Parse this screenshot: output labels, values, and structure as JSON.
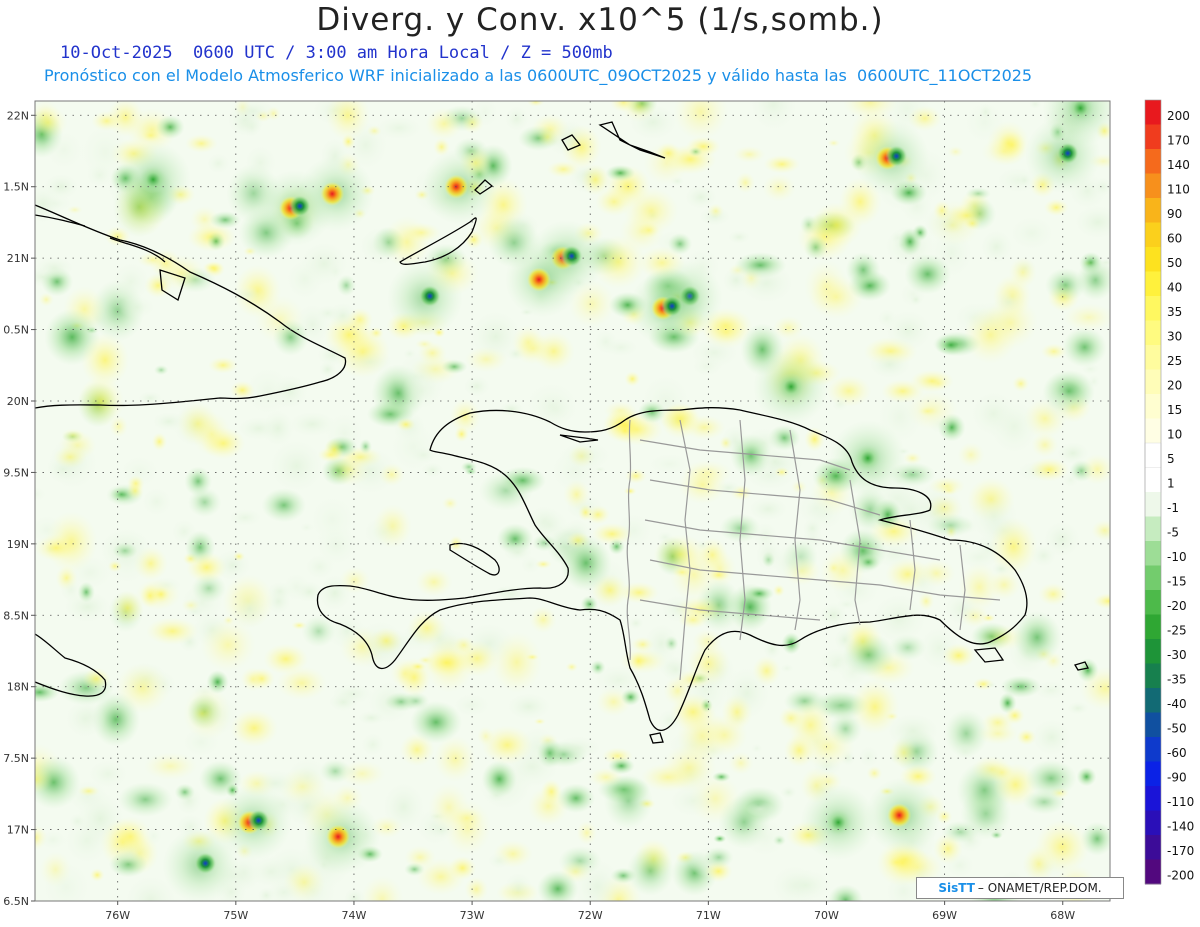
{
  "title": "Diverg. y Conv. x10^5 (1/s,somb.)",
  "subtitle_line1": "10-Oct-2025  0600 UTC / 3:00 am Hora Local / Z = 500mb",
  "subtitle_line2": "Pronóstico con el Modelo Atmosferico WRF inicializado a las 0600UTC_09OCT2025 y válido hasta las  0600UTC_11OCT2025",
  "credit": {
    "brand": "SisTT",
    "org": "– ONAMET/REP.DOM."
  },
  "map": {
    "lat_ticks": [
      "22N",
      "1.5N",
      "21N",
      "0.5N",
      "20N",
      "9.5N",
      "19N",
      "8.5N",
      "18N",
      "7.5N",
      "17N",
      "6.5N"
    ],
    "lon_ticks": [
      "76W",
      "75W",
      "74W",
      "73W",
      "72W",
      "71W",
      "70W",
      "69W",
      "68W"
    ],
    "lat_range": [
      16.5,
      22.1
    ],
    "lon_range": [
      -76.7,
      -67.6
    ],
    "grid": "dotted"
  },
  "colorbar": {
    "levels": [
      "200",
      "170",
      "140",
      "110",
      "90",
      "60",
      "50",
      "40",
      "35",
      "30",
      "25",
      "20",
      "15",
      "10",
      "5",
      "1",
      "-1",
      "-5",
      "-10",
      "-15",
      "-20",
      "-25",
      "-30",
      "-35",
      "-40",
      "-50",
      "-60",
      "-90",
      "-110",
      "-140",
      "-170",
      "-200"
    ],
    "colors": [
      "#e8191e",
      "#f03c1e",
      "#f56a1c",
      "#f7901c",
      "#f9b41a",
      "#fbd01c",
      "#fde21f",
      "#fff13c",
      "#fff860",
      "#fffb80",
      "#fffc9e",
      "#fffdb8",
      "#fffed0",
      "#fffee4",
      "#ffffff",
      "#ffffff",
      "#eef8ea",
      "#c6ecc0",
      "#9ddd96",
      "#73cc6d",
      "#4dba4a",
      "#2fa733",
      "#1e9438",
      "#17804e",
      "#126a74",
      "#1050a0",
      "#0e3acc",
      "#0b22e6",
      "#1a14d8",
      "#2a0fb8",
      "#3c0c98",
      "#52087e"
    ]
  },
  "blobs": [
    {
      "lon": -71.2,
      "lat": 20.72,
      "kind": "conv"
    },
    {
      "lon": -71.35,
      "lat": 20.65,
      "kind": "mixed"
    },
    {
      "lon": -72.2,
      "lat": 21.0,
      "kind": "mixed"
    },
    {
      "lon": -72.4,
      "lat": 20.85,
      "kind": "div"
    },
    {
      "lon": -73.4,
      "lat": 20.72,
      "kind": "conv"
    },
    {
      "lon": -74.15,
      "lat": 21.45,
      "kind": "div"
    },
    {
      "lon": -74.5,
      "lat": 21.35,
      "kind": "mixed"
    },
    {
      "lon": -75.3,
      "lat": 16.75,
      "kind": "conv"
    },
    {
      "lon": -74.1,
      "lat": 16.95,
      "kind": "div"
    },
    {
      "lon": -74.85,
      "lat": 17.05,
      "kind": "mixed"
    },
    {
      "lon": -68.0,
      "lat": 21.72,
      "kind": "conv"
    },
    {
      "lon": -69.45,
      "lat": 21.7,
      "kind": "mixed"
    },
    {
      "lon": -69.35,
      "lat": 17.1,
      "kind": "div"
    },
    {
      "lon": -69.9,
      "lat": 17.05,
      "kind": "green"
    },
    {
      "lon": -73.1,
      "lat": 21.5,
      "kind": "div"
    },
    {
      "lon": -75.7,
      "lat": 21.55,
      "kind": "green"
    },
    {
      "lon": -67.85,
      "lat": 22.05,
      "kind": "green"
    },
    {
      "lon": -70.3,
      "lat": 20.1,
      "kind": "green"
    },
    {
      "lon": -69.65,
      "lat": 19.6,
      "kind": "green"
    }
  ]
}
